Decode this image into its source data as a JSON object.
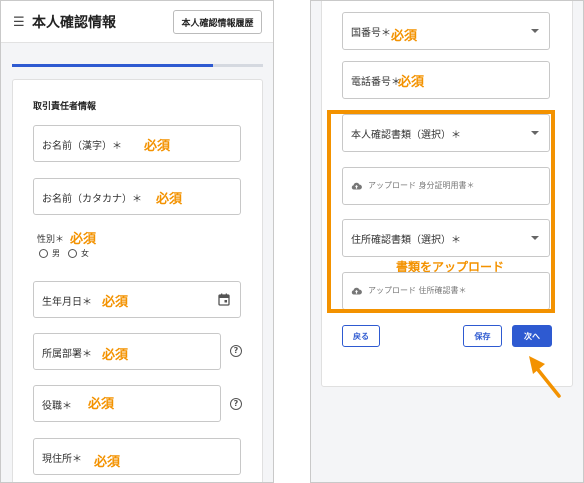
{
  "header": {
    "title": "本人確認情報",
    "history_button": "本人確認情報履歴"
  },
  "progress": {
    "value": 0.8
  },
  "left_form": {
    "section_title": "取引責任者情報",
    "name_kanji": "お名前（漢字）＊",
    "name_kana": "お名前（カタカナ）＊",
    "gender_label": "性別＊",
    "gender_male": "男",
    "gender_female": "女",
    "birthdate": "生年月日＊",
    "department": "所属部署＊",
    "position": "役職＊",
    "address": "現住所＊"
  },
  "right_form": {
    "country_code": "国番号＊",
    "phone": "電話番号＊",
    "id_doc_type": "本人確認書類（選択）＊",
    "id_upload": "アップロード 身分証明用書＊",
    "address_doc_type": "住所確認書類（選択）＊",
    "address_upload": "アップロード 住所確認書＊",
    "back_button": "戻る",
    "save_button": "保存",
    "next_button": "次へ"
  },
  "annotations": {
    "required": "必須",
    "upload_callout": "書類をアップロード",
    "accent_color": "#f39200",
    "primary_color": "#2e5ad1"
  },
  "icons": [
    "menu-icon",
    "help-icon",
    "calendar-icon",
    "cloud-upload-icon",
    "chevron-down-icon",
    "arrow-annotation-icon"
  ]
}
